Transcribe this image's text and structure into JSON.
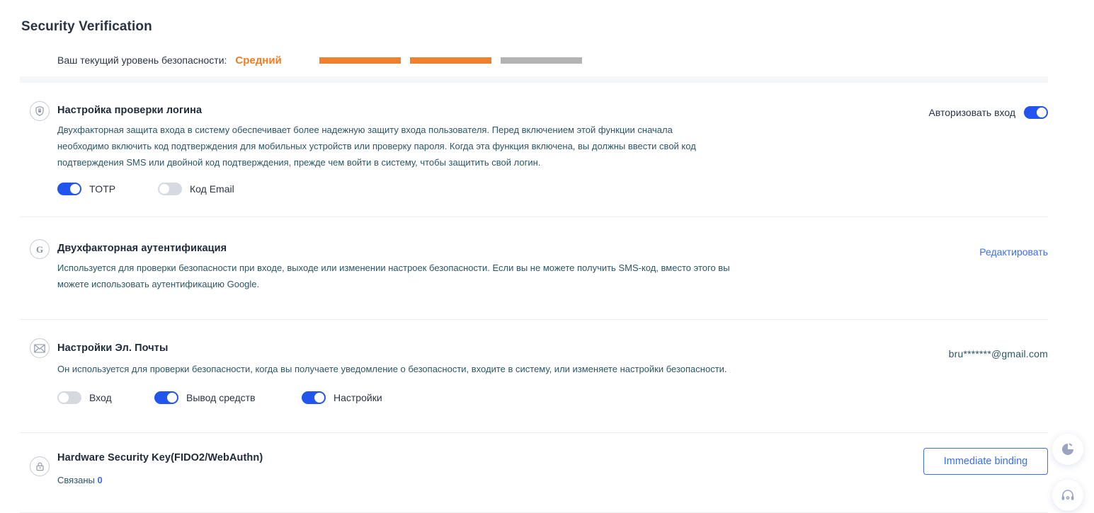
{
  "header": {
    "title": "Security Verification",
    "level_label": "Ваш текущий уровень безопасности:",
    "level_value": "Средний",
    "bars": [
      {
        "state": "filled",
        "color": "#F0802D"
      },
      {
        "state": "filled",
        "color": "#F0802D"
      },
      {
        "state": "empty",
        "color": "#b3b3b3"
      }
    ]
  },
  "sections": {
    "login": {
      "icon": "shield-lock-icon",
      "title": "Настройка проверки логина",
      "desc": "Двухфакторная защита входа в систему обеспечивает более надежную защиту входа пользователя. Перед включением этой функции сначала необходимо включить код подтверждения для мобильных устройств или проверку пароля. Когда эта функция включена, вы должны ввести свой код подтверждения SMS или двойной код подтверждения, прежде чем войти в систему, чтобы защитить свой логин.",
      "right_label": "Авторизовать вход",
      "right_toggle": "on",
      "toggles": [
        {
          "label": "TOTP",
          "state": "on"
        },
        {
          "label": "Код Email",
          "state": "off"
        }
      ]
    },
    "twofa": {
      "icon": "google-g-icon",
      "title": "Двухфакторная аутентификация",
      "desc": "Используется для проверки безопасности при входе, выходе или изменении настроек безопасности. Если вы не можете получить SMS-код, вместо этого вы можете использовать аутентификацию Google.",
      "action": "Редактировать"
    },
    "email": {
      "icon": "envelope-icon",
      "title": "Настройки Эл. Почты",
      "desc": "Он используется для проверки безопасности, когда вы получаете уведомление о безопасности, входите в систему, или изменяете настройки безопасности.",
      "value": "bru*******@gmail.com",
      "toggles": [
        {
          "label": "Вход",
          "state": "off"
        },
        {
          "label": "Вывод средств",
          "state": "on"
        },
        {
          "label": "Настройки",
          "state": "on"
        }
      ]
    },
    "hardware": {
      "icon": "lock-icon",
      "title": "Hardware Security Key(FIDO2/WebAuthn)",
      "bound_label": "Связаны",
      "bound_count": "0",
      "button": "Immediate binding"
    }
  },
  "floating": {
    "chart": "pie-chart-icon",
    "support": "headset-icon"
  },
  "colors": {
    "accent_blue": "#3b6ef0",
    "toggle_on": "#2255ee",
    "orange": "#F0802D",
    "gray_bar": "#b3b3b3"
  }
}
